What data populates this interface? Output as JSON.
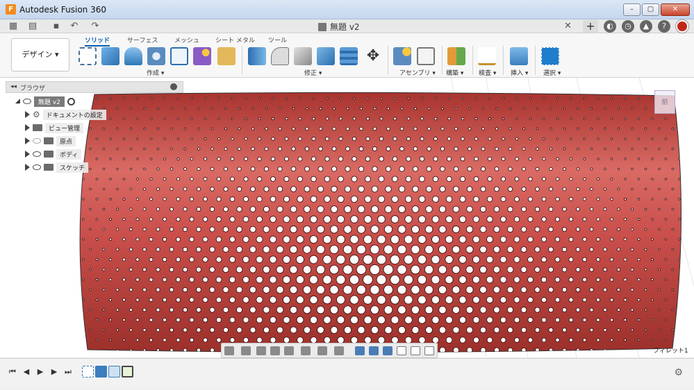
{
  "window": {
    "title": "Autodesk Fusion 360",
    "app_icon": "F"
  },
  "document": {
    "tab_title": "無題 v2",
    "close": "✕"
  },
  "ribbon": {
    "workspace": "デザイン ▾",
    "tabs": [
      "ソリッド",
      "サーフェス",
      "メッシュ",
      "シート メタル",
      "ツール"
    ],
    "groups": [
      "作成 ▾",
      "修正 ▾",
      "アセンブリ ▾",
      "構築 ▾",
      "検査 ▾",
      "挿入 ▾",
      "選択 ▾"
    ]
  },
  "browser": {
    "title": "ブラウザ",
    "root": "無題 v2",
    "items": [
      "ドキュメントの設定",
      "ビュー管理",
      "原点",
      "ボディ",
      "スケッチ"
    ]
  },
  "viewport": {
    "status": "フィレット1",
    "body_color": "#c94f4b",
    "viewcube_label": "前"
  },
  "colors": {
    "accent": "#0b5fb0",
    "body": "#c94f4b"
  }
}
